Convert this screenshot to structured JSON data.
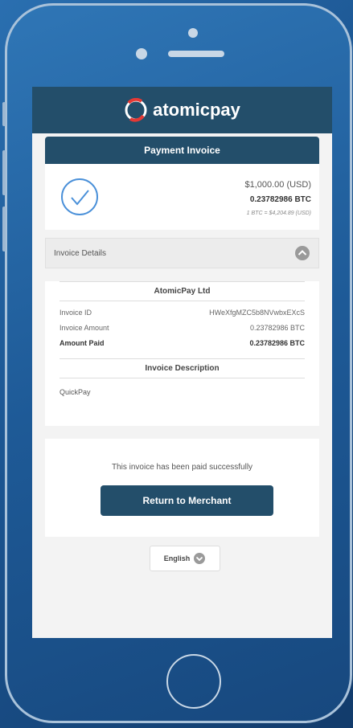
{
  "app": {
    "brand": "atomicpay"
  },
  "invoice": {
    "title": "Payment Invoice",
    "usd_amount": "$1,000.00 (USD)",
    "btc_amount": "0.23782986 BTC",
    "rate": "1 BTC = $4,204.89 (USD)"
  },
  "details": {
    "header": "Invoice Details",
    "merchant": "AtomicPay Ltd",
    "rows": [
      {
        "label": "Invoice ID",
        "value": "HWeXfgMZC5b8NVwbxEXcS"
      },
      {
        "label": "Invoice Amount",
        "value": "0.23782986 BTC"
      },
      {
        "label": "Amount Paid",
        "value": "0.23782986 BTC"
      }
    ],
    "description_title": "Invoice Description",
    "description": "QuickPay"
  },
  "status": {
    "message": "This invoice has been paid successfully",
    "return_label": "Return to Merchant"
  },
  "language": {
    "selected": "English"
  },
  "colors": {
    "primary": "#234e6a",
    "accent": "#e53935",
    "success": "#4a90d9"
  }
}
